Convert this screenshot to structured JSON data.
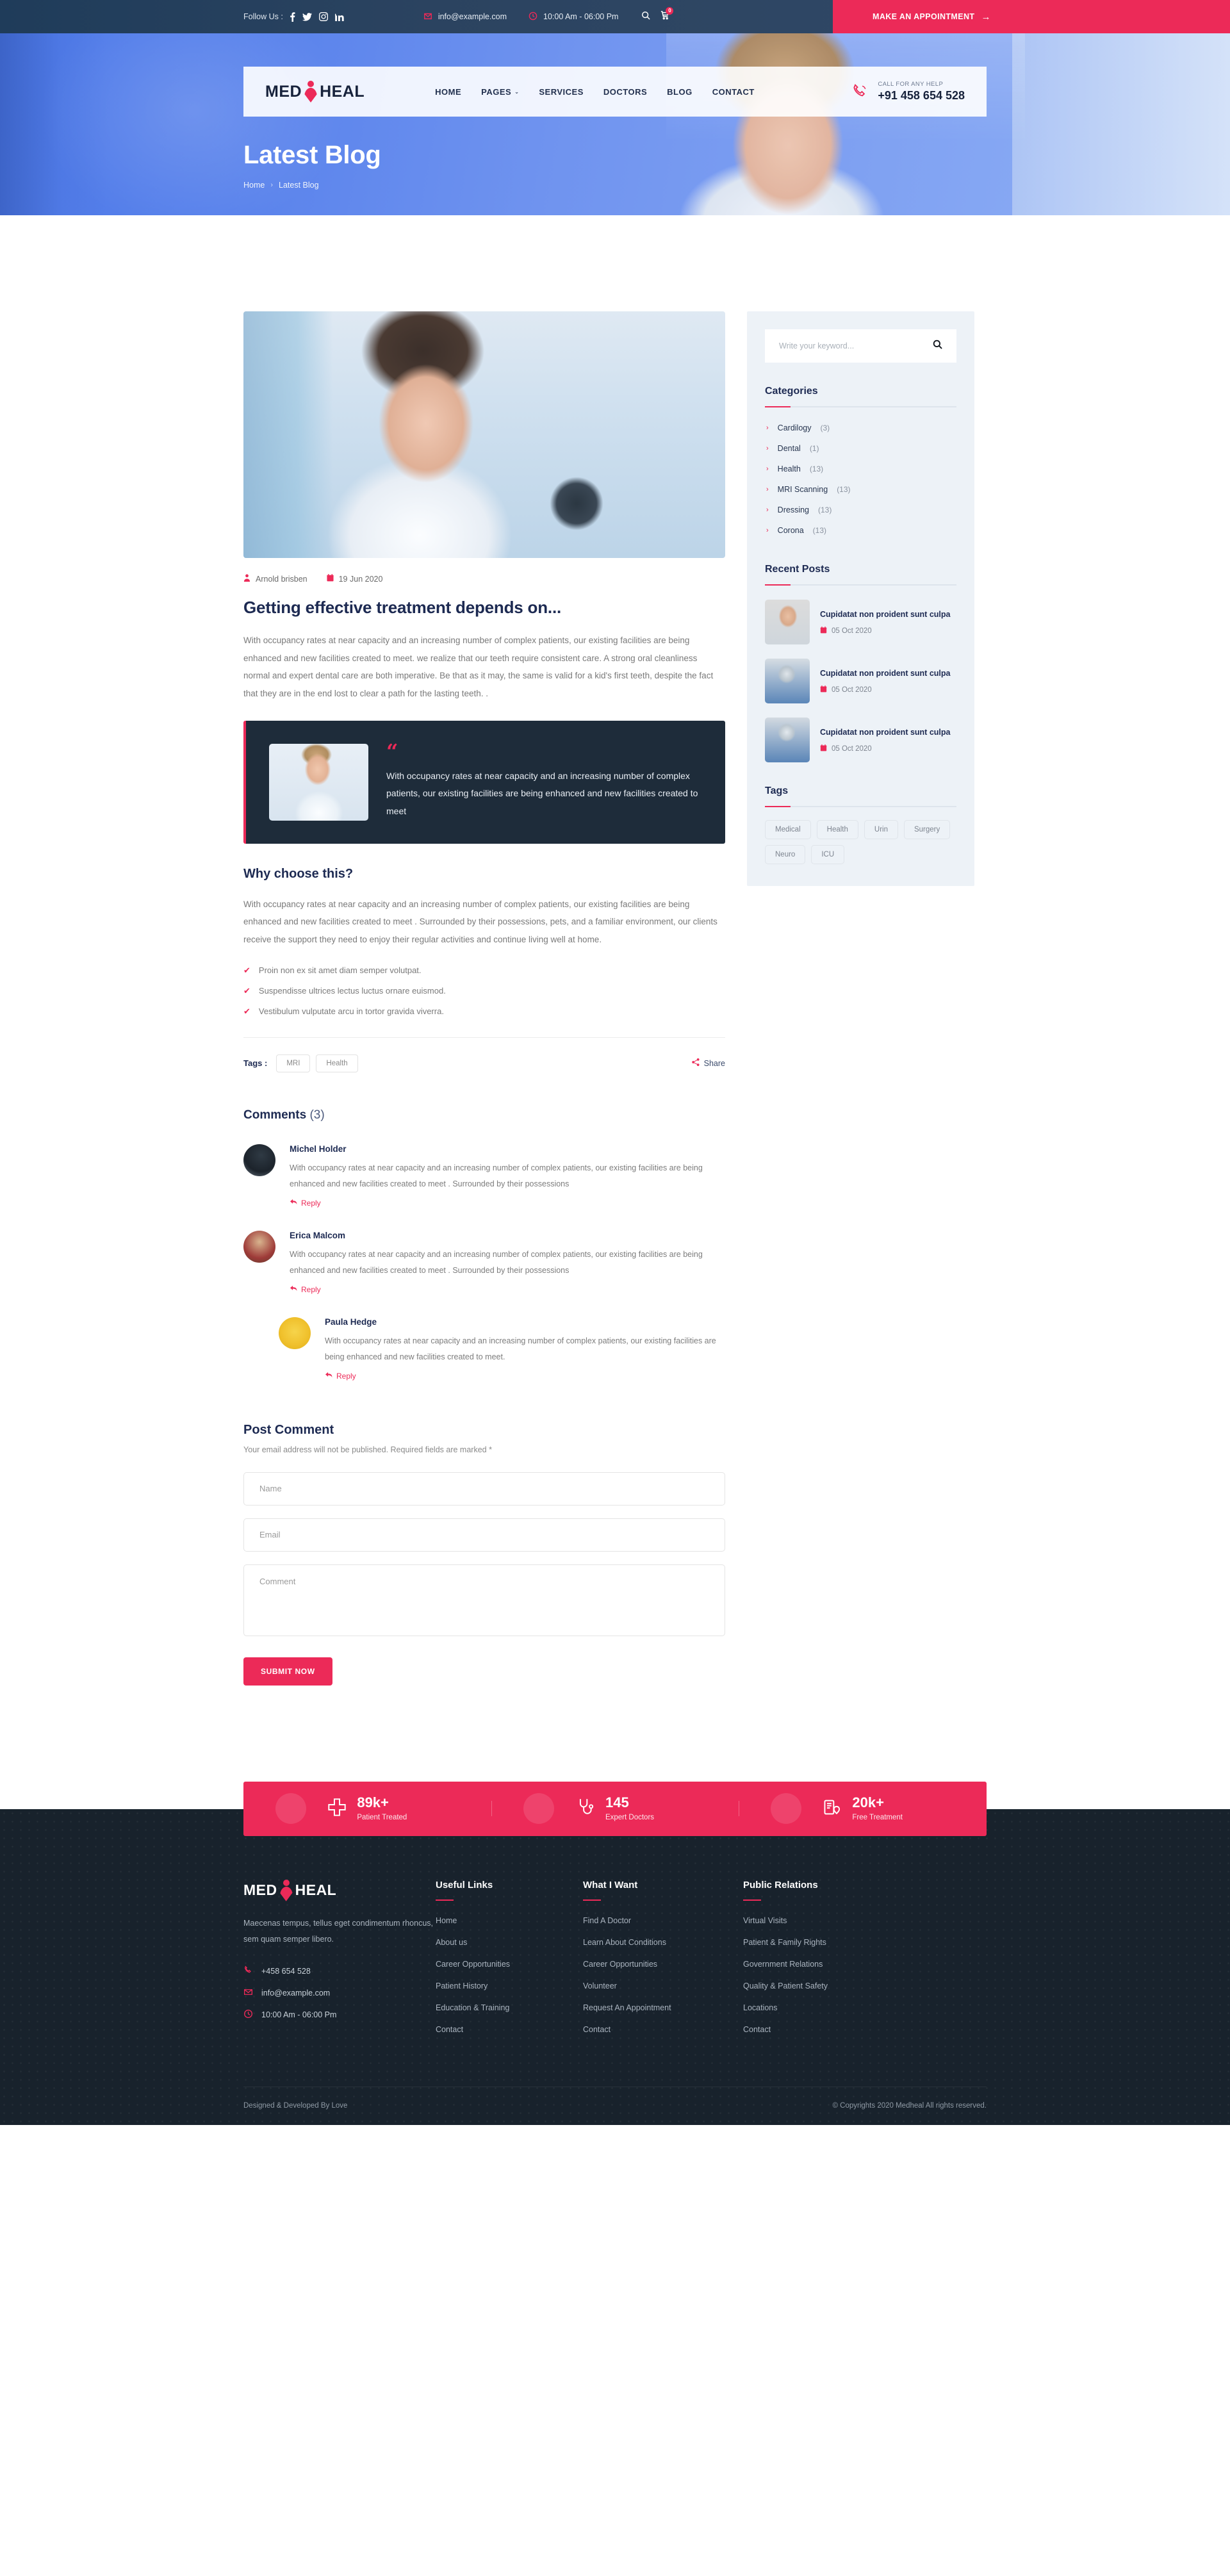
{
  "topbar": {
    "follow_label": "Follow Us :",
    "social": [
      "facebook-icon",
      "twitter-icon",
      "instagram-icon",
      "linkedin-icon"
    ],
    "email": "info@example.com",
    "hours": "10:00 Am - 06:00 Pm",
    "cart_count": "0",
    "appointment_label": "MAKE AN APPOINTMENT",
    "appointment_arrow": "→"
  },
  "nav": {
    "logo_left": "MED",
    "logo_right": "HEAL",
    "links": [
      {
        "label": "HOME",
        "caret": ""
      },
      {
        "label": "PAGES",
        "caret": "⌄"
      },
      {
        "label": "SERVICES",
        "caret": ""
      },
      {
        "label": "DOCTORS",
        "caret": ""
      },
      {
        "label": "BLOG",
        "caret": ""
      },
      {
        "label": "CONTACT",
        "caret": ""
      }
    ],
    "call_label": "CALL FOR ANY HELP",
    "call_number": "+91 458 654 528"
  },
  "hero": {
    "title": "Latest Blog",
    "crumb_home": "Home",
    "crumb_sep": "›",
    "crumb_current": "Latest Blog"
  },
  "post": {
    "author": "Arnold brisben",
    "date": "19 Jun 2020",
    "title": "Getting effective treatment depends on...",
    "paragraph": "With occupancy rates at near capacity and an increasing number of complex patients, our existing facilities are being enhanced and new facilities created to meet. we realize that our teeth require consistent care. A strong oral cleanliness normal and expert dental care are both imperative. Be that as it may, the same is valid for a kid's first teeth, despite the fact that they are in the end lost to clear a path for the lasting teeth. .",
    "quote_mark": "“",
    "quote": "With occupancy rates at near capacity and an increasing number of complex patients, our existing facilities are being enhanced and new facilities created to meet",
    "sub_title": "Why choose this?",
    "paragraph2": "With occupancy rates at near capacity and an increasing number of complex patients, our existing facilities are being enhanced and new facilities created to meet . Surrounded by their possessions, pets, and a familiar environment, our clients receive the support they need to enjoy their regular activities and continue living well at home.",
    "checklist": [
      "Proin non ex sit amet diam semper volutpat.",
      "Suspendisse ultrices lectus luctus ornare euismod.",
      "Vestibulum vulputate arcu in tortor gravida viverra."
    ],
    "check_glyph": "✔",
    "tags_label": "Tags :",
    "tags": [
      "MRI",
      "Health"
    ],
    "share_label": "Share"
  },
  "comments": {
    "title": "Comments",
    "count": "(3)",
    "reply_label": "Reply",
    "items": [
      {
        "name": "Michel Holder",
        "text": "With occupancy rates at near capacity and an increasing number of complex patients, our existing facilities are being enhanced and new facilities created to meet . Surrounded by their possessions",
        "is_reply": false
      },
      {
        "name": "Erica Malcom",
        "text": "With occupancy rates at near capacity and an increasing number of complex patients, our existing facilities are being enhanced and new facilities created to meet . Surrounded by their possessions",
        "is_reply": false
      },
      {
        "name": "Paula Hedge",
        "text": "With occupancy rates at near capacity and an increasing number of complex patients, our existing facilities are being enhanced and new facilities created to meet.",
        "is_reply": true
      }
    ]
  },
  "post_comment": {
    "title": "Post Comment",
    "note": "Your email address will not be published. Required fields are marked *",
    "name_placeholder": "Name",
    "email_placeholder": "Email",
    "comment_placeholder": "Comment",
    "submit_label": "SUBMIT NOW"
  },
  "sidebar": {
    "search_placeholder": "Write your keyword...",
    "categories_title": "Categories",
    "categories": [
      {
        "label": "Cardilogy",
        "count": "(3)"
      },
      {
        "label": "Dental",
        "count": "(1)"
      },
      {
        "label": "Health",
        "count": "(13)"
      },
      {
        "label": "MRI Scanning",
        "count": "(13)"
      },
      {
        "label": "Dressing",
        "count": "(13)"
      },
      {
        "label": "Corona",
        "count": "(13)"
      }
    ],
    "recent_title": "Recent Posts",
    "recent": [
      {
        "title": "Cupidatat non proident sunt culpa",
        "date": "05 Oct 2020"
      },
      {
        "title": "Cupidatat non proident sunt culpa",
        "date": "05 Oct 2020"
      },
      {
        "title": "Cupidatat non proident sunt culpa",
        "date": "05 Oct 2020"
      }
    ],
    "tags_title": "Tags",
    "tags": [
      "Medical",
      "Health",
      "Urin",
      "Surgery",
      "Neuro",
      "ICU"
    ]
  },
  "stats": [
    {
      "num": "89k+",
      "cap": "Patient Treated",
      "icon": "cross-icon"
    },
    {
      "num": "145",
      "cap": "Expert Doctors",
      "icon": "stethoscope-icon"
    },
    {
      "num": "20k+",
      "cap": "Free Treatment",
      "icon": "clipboard-heart-icon"
    }
  ],
  "footer": {
    "logo_left": "MED",
    "logo_right": "HEAL",
    "about": "Maecenas tempus, tellus eget condimentum rhoncus, sem quam semper libero.",
    "phone": "+458 654 528",
    "email": "info@example.com",
    "hours": "10:00 Am - 06:00 Pm",
    "columns": [
      {
        "title": "Useful Links",
        "links": [
          "Home",
          "About us",
          "Career Opportunities",
          "Patient History",
          "Education & Training",
          "Contact"
        ]
      },
      {
        "title": "What I Want",
        "links": [
          "Find A Doctor",
          "Learn About Conditions",
          "Career Opportunities",
          "Volunteer",
          "Request An Appointment",
          "Contact"
        ]
      },
      {
        "title": "Public Relations",
        "links": [
          "Virtual Visits",
          "Patient & Family Rights",
          "Government Relations",
          "Quality & Patient Safety",
          "Locations",
          "Contact"
        ]
      }
    ],
    "credit": "Designed & Developed By Love",
    "copyright": "© Copyrights 2020  Medheal All rights reserved."
  },
  "colors": {
    "accent": "#ec2a58",
    "dark": "#18222c",
    "navy": "#1d2a52"
  }
}
